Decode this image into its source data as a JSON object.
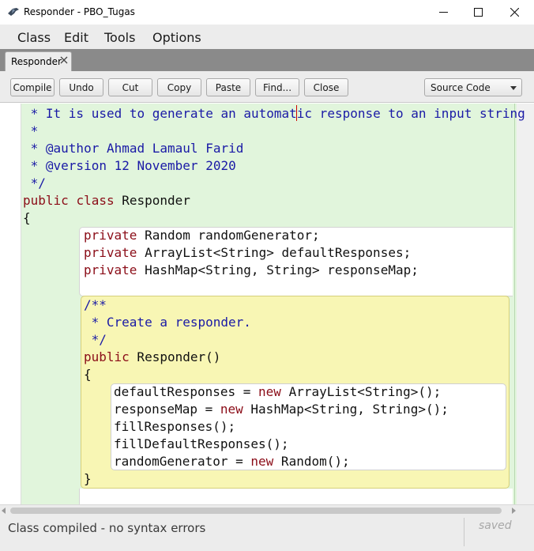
{
  "window": {
    "title": "Responder - PBO_Tugas",
    "app_icon": "bluej-bird-icon",
    "controls": [
      "minimize-icon",
      "maximize-icon",
      "close-icon"
    ]
  },
  "menu": {
    "items": [
      "Class",
      "Edit",
      "Tools",
      "Options"
    ]
  },
  "tabs": [
    {
      "label": "Responder",
      "active": true
    }
  ],
  "toolbar": {
    "buttons": [
      "Compile",
      "Undo",
      "Cut",
      "Copy",
      "Paste",
      "Find...",
      "Close"
    ],
    "view_select": "Source Code"
  },
  "editor": {
    "lines": [
      " * It is used to generate an automatic response to an input string",
      " *",
      " * @author Ahmad Lamaul Farid",
      " * @version 12 November 2020",
      " */",
      "public class Responder",
      "{",
      "private Random randomGenerator;",
      "private ArrayList<String> defaultResponses;",
      "private HashMap<String, String> responseMap;",
      "/**",
      " * Create a responder.",
      " */",
      "public Responder()",
      "{",
      "defaultResponses = new ArrayList<String>();",
      "responseMap = new HashMap<String, String>();",
      "fillResponses();",
      "fillDefaultResponses();",
      "randomGenerator = new Random();",
      "}"
    ],
    "colors": {
      "class_scope": "#e1f5dc",
      "method_scope": "#f8f6b4",
      "comment": "#1a1aa6",
      "keyword": "#8b0d18"
    }
  },
  "status": {
    "message": "Class compiled - no syntax errors",
    "saved": "saved"
  }
}
